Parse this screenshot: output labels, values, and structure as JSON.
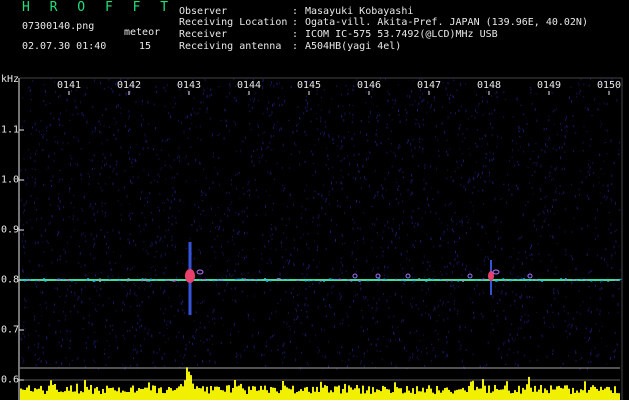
{
  "header": {
    "app_title": "H R O F F T",
    "filename": "07300140.png",
    "meteor_label": "meteor",
    "datetime": "02.07.30 01:40",
    "meteor_count": "15",
    "fields": [
      {
        "key": "Observer",
        "value": "Masayuki Kobayashi"
      },
      {
        "key": "Receiving Location",
        "value": "Ogata-vill. Akita-Pref. JAPAN (139.96E, 40.02N)"
      },
      {
        "key": "Receiver",
        "value": "ICOM IC-575 53.7492(@LCD)MHz USB"
      },
      {
        "key": "Receiving antenna",
        "value": "A504HB(yagi 4el)"
      }
    ]
  },
  "spectrogram": {
    "unit_label": "kHz",
    "time_ticks": [
      "0141",
      "0142",
      "0143",
      "0144",
      "0145",
      "0146",
      "0147",
      "0148",
      "0149",
      "0150"
    ],
    "freq_ticks": [
      "1.1",
      "1.0",
      "0.9",
      "0.8",
      "0.7",
      "0.6"
    ],
    "carrier_freq_khz": 0.8,
    "meteor_times": [
      "0143",
      "0148"
    ],
    "colors": {
      "background": "#000000",
      "noise": "#23238c",
      "carrier": "#38e0a0",
      "meteor": "#e8406a",
      "level_bars": "#f0f000",
      "text": "#e8e8e8",
      "title": "#1fe07a"
    }
  }
}
